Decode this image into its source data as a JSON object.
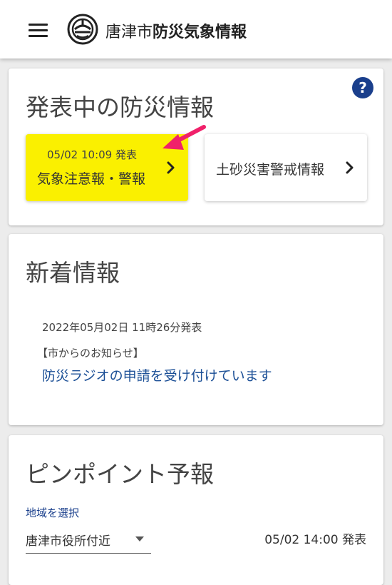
{
  "header": {
    "title_city": "唐津市",
    "title_main": "防災気象情報",
    "menu_icon": "hamburger-menu-icon",
    "logo_icon": "city-emblem-icon"
  },
  "alerts": {
    "heading": "発表中の防災情報",
    "help_icon": "help-circle-icon",
    "help_glyph": "?",
    "weather_tile": {
      "issued": "05/02 10:09 発表",
      "name": "気象注意報・警報",
      "bg": "#faf000"
    },
    "sediment_tile": {
      "name": "土砂災害警戒情報"
    },
    "annotation_arrow_color": "#f0216a"
  },
  "news": {
    "heading": "新着情報",
    "items": [
      {
        "date": "2022年05月02日 11時26分発表",
        "category": "【市からのお知らせ】",
        "title": "防災ラジオの申請を受け付けています"
      }
    ]
  },
  "pinpoint": {
    "heading": "ピンポイント予報",
    "select_label": "地域を選択",
    "selected_area": "唐津市役所付近",
    "forecast_time": "05/02 14:00 発表"
  }
}
